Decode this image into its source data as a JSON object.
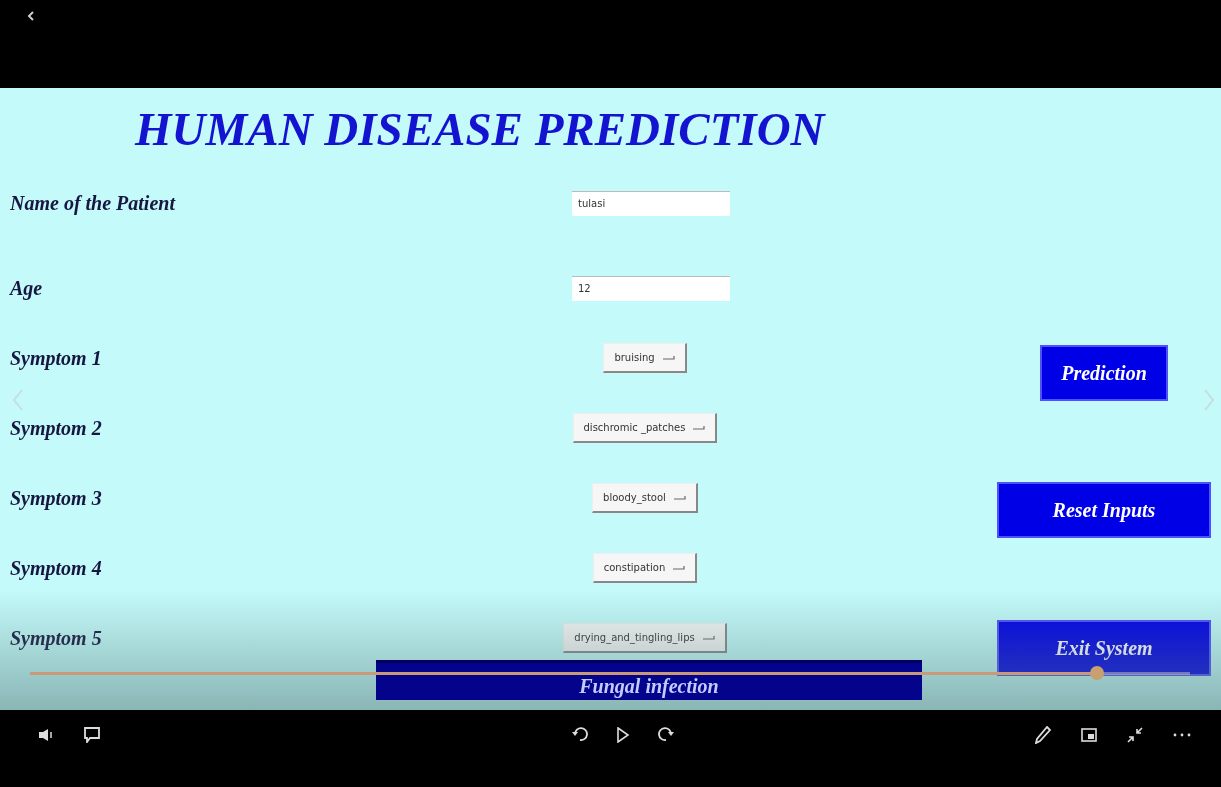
{
  "app": {
    "title": "HUMAN DISEASE PREDICTION",
    "fields": [
      {
        "label": "Name of the Patient",
        "kind": "entry",
        "value": "tulasi"
      },
      {
        "label": "Age",
        "kind": "entry",
        "value": "12"
      },
      {
        "label": "Symptom 1",
        "kind": "dropdown",
        "value": "bruising"
      },
      {
        "label": "Symptom 2",
        "kind": "dropdown",
        "value": "dischromic _patches"
      },
      {
        "label": "Symptom 3",
        "kind": "dropdown",
        "value": "bloody_stool"
      },
      {
        "label": "Symptom 4",
        "kind": "dropdown",
        "value": "constipation"
      },
      {
        "label": "Symptom 5",
        "kind": "dropdown",
        "value": "drying_and_tingling_lips"
      }
    ],
    "buttons": [
      "Prediction",
      "Reset Inputs",
      "Exit System"
    ],
    "result": "Fungal infection"
  },
  "player": {
    "seek": {
      "level": 0.92
    }
  }
}
